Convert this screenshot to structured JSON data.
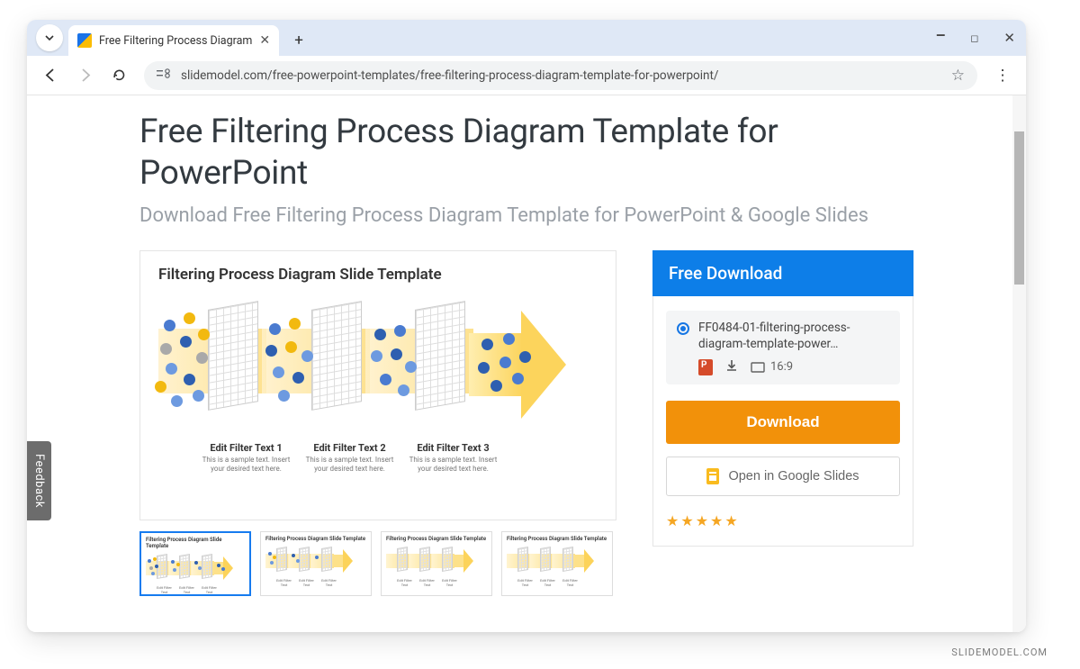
{
  "browser": {
    "tab_title": "Free Filtering Process Diagram",
    "url": "slidemodel.com/free-powerpoint-templates/free-filtering-process-diagram-template-for-powerpoint/"
  },
  "page": {
    "title": "Free Filtering Process Diagram Template for PowerPoint",
    "subtitle": "Download Free Filtering Process Diagram Template for PowerPoint & Google Slides"
  },
  "preview": {
    "title": "Filtering Process Diagram Slide Template",
    "filters": [
      {
        "label": "Edit Filter Text 1",
        "sub": "This is a sample text. Insert your desired text here."
      },
      {
        "label": "Edit Filter Text 2",
        "sub": "This is a sample text. Insert your desired text here."
      },
      {
        "label": "Edit Filter Text 3",
        "sub": "This is a sample text. Insert your desired text here."
      }
    ]
  },
  "thumbs": {
    "title": "Filtering Process Diagram Slide Template",
    "label": "Edit Filter Text"
  },
  "download": {
    "header": "Free Download",
    "file_name": "FF0484-01-filtering-process-diagram-template-power…",
    "aspect": "16:9",
    "download_btn": "Download",
    "google_btn": "Open in Google Slides",
    "rating": 5
  },
  "feedback": "Feedback",
  "attribution": "SLIDEMODEL.COM"
}
